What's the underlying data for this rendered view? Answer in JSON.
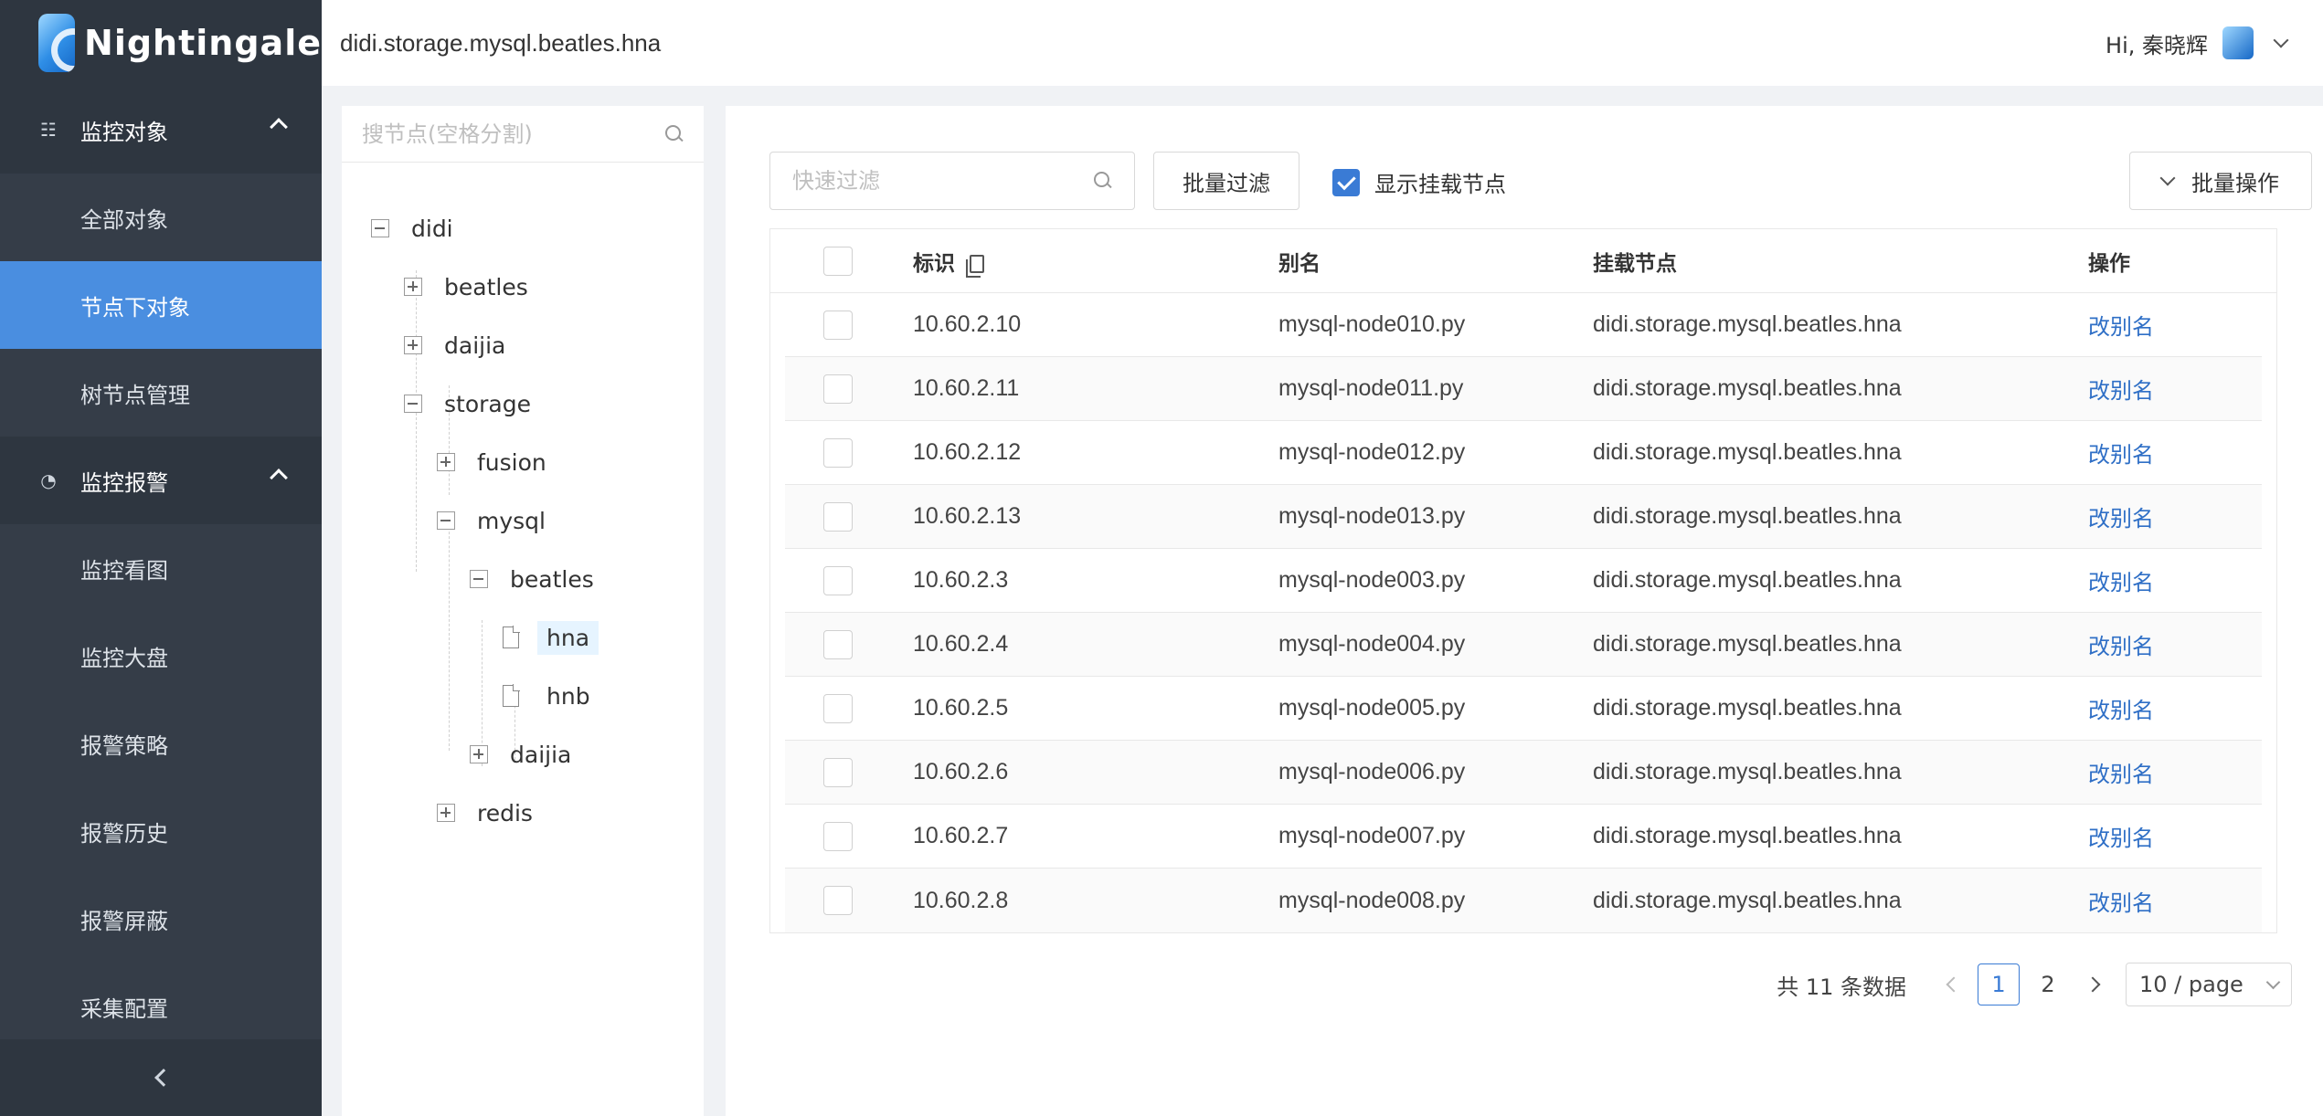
{
  "app": {
    "name": "Nightingale"
  },
  "sidebar": {
    "groups": [
      {
        "label": "监控对象",
        "icon": "hierarchy-icon",
        "items": [
          {
            "label": "全部对象"
          },
          {
            "label": "节点下对象",
            "active": true
          },
          {
            "label": "树节点管理"
          }
        ]
      },
      {
        "label": "监控报警",
        "icon": "dashboard-gauge-icon",
        "items": [
          {
            "label": "监控看图"
          },
          {
            "label": "监控大盘"
          },
          {
            "label": "报警策略"
          },
          {
            "label": "报警历史"
          },
          {
            "label": "报警屏蔽"
          },
          {
            "label": "采集配置"
          }
        ]
      }
    ]
  },
  "header": {
    "breadcrumb": "didi.storage.mysql.beatles.hna",
    "greeting": "Hi, 秦晓辉"
  },
  "tree": {
    "search_placeholder": "搜节点(空格分割)",
    "nodes": [
      {
        "label": "didi",
        "state": "expanded"
      },
      {
        "label": "beatles",
        "state": "collapsed"
      },
      {
        "label": "daijia",
        "state": "collapsed"
      },
      {
        "label": "storage",
        "state": "expanded"
      },
      {
        "label": "fusion",
        "state": "collapsed"
      },
      {
        "label": "mysql",
        "state": "expanded"
      },
      {
        "label": "beatles",
        "state": "expanded"
      },
      {
        "label": "hna",
        "state": "leaf",
        "selected": true
      },
      {
        "label": "hnb",
        "state": "leaf"
      },
      {
        "label": "daijia",
        "state": "collapsed"
      },
      {
        "label": "redis",
        "state": "collapsed"
      }
    ]
  },
  "toolbar": {
    "quick_filter_placeholder": "快速过滤",
    "batch_filter_label": "批量过滤",
    "show_mount_label": "显示挂载节点",
    "show_mount_checked": true,
    "batch_op_label": "批量操作"
  },
  "table": {
    "columns": {
      "id": "标识",
      "alias": "别名",
      "mount": "挂载节点",
      "op": "操作"
    },
    "rows": [
      {
        "id": "10.60.2.10",
        "alias": "mysql-node010.py",
        "mount": "didi.storage.mysql.beatles.hna",
        "op": "改别名"
      },
      {
        "id": "10.60.2.11",
        "alias": "mysql-node011.py",
        "mount": "didi.storage.mysql.beatles.hna",
        "op": "改别名"
      },
      {
        "id": "10.60.2.12",
        "alias": "mysql-node012.py",
        "mount": "didi.storage.mysql.beatles.hna",
        "op": "改别名"
      },
      {
        "id": "10.60.2.13",
        "alias": "mysql-node013.py",
        "mount": "didi.storage.mysql.beatles.hna",
        "op": "改别名"
      },
      {
        "id": "10.60.2.3",
        "alias": "mysql-node003.py",
        "mount": "didi.storage.mysql.beatles.hna",
        "op": "改别名"
      },
      {
        "id": "10.60.2.4",
        "alias": "mysql-node004.py",
        "mount": "didi.storage.mysql.beatles.hna",
        "op": "改别名"
      },
      {
        "id": "10.60.2.5",
        "alias": "mysql-node005.py",
        "mount": "didi.storage.mysql.beatles.hna",
        "op": "改别名"
      },
      {
        "id": "10.60.2.6",
        "alias": "mysql-node006.py",
        "mount": "didi.storage.mysql.beatles.hna",
        "op": "改别名"
      },
      {
        "id": "10.60.2.7",
        "alias": "mysql-node007.py",
        "mount": "didi.storage.mysql.beatles.hna",
        "op": "改别名"
      },
      {
        "id": "10.60.2.8",
        "alias": "mysql-node008.py",
        "mount": "didi.storage.mysql.beatles.hna",
        "op": "改别名"
      }
    ]
  },
  "pagination": {
    "total_text": "共 11 条数据",
    "pages": [
      "1",
      "2"
    ],
    "current": "1",
    "page_size": "10 / page"
  },
  "colors": {
    "accent": "#4a8ee0",
    "sidebar": "#353d48",
    "link": "#2f6fc6"
  }
}
